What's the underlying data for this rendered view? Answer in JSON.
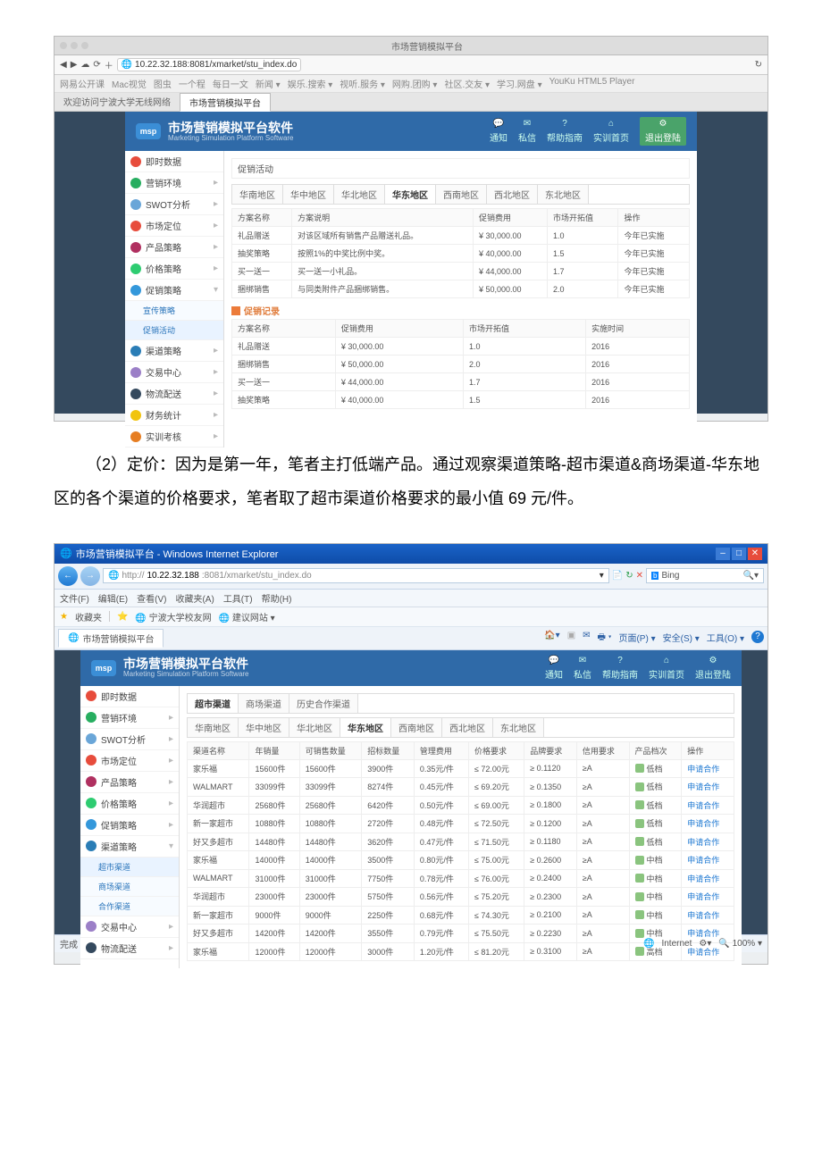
{
  "doc": {
    "paragraph": "（2）定价：因为是第一年，笔者主打低端产品。通过观察渠道策略-超市渠道&商场渠道-华东地区的各个渠道的价格要求，笔者取了超市渠道价格要求的最小值 69 元/件。"
  },
  "shot1": {
    "window_title": "市场营销模拟平台",
    "url": "10.22.32.188:8081/xmarket/stu_index.do",
    "bookmarks": [
      "网易公开课",
      "Mac视觉",
      "图虫",
      "一个程",
      "每日一文",
      "新闻 ▾",
      "娱乐.搜索 ▾",
      "视听.服务 ▾",
      "网购.团购 ▾",
      "社区.交友 ▾",
      "学习.网盘 ▾",
      "YouKu HTML5 Player"
    ],
    "tabs": [
      "欢迎访问宁波大学无线网络",
      "市场营销模拟平台"
    ],
    "app_title": "市场营销模拟平台软件",
    "app_sub": "Marketing Simulation Platform Software",
    "top_icons": [
      {
        "icon": "message-icon",
        "label": "通知"
      },
      {
        "icon": "mail-icon",
        "label": "私信"
      },
      {
        "icon": "help-icon",
        "label": "帮助指南"
      },
      {
        "icon": "home-icon",
        "label": "实训首页"
      },
      {
        "icon": "gear-icon",
        "label": "退出登陆",
        "hl": true
      }
    ],
    "sidebar": [
      {
        "label": "即时数据",
        "color": "#e74c3c"
      },
      {
        "label": "营销环境",
        "color": "#27ae60",
        "arrow": true
      },
      {
        "label": "SWOT分析",
        "color": "#6aa6d8",
        "arrow": true
      },
      {
        "label": "市场定位",
        "color": "#e74c3c",
        "arrow": true
      },
      {
        "label": "产品策略",
        "color": "#b03060",
        "arrow": true
      },
      {
        "label": "价格策略",
        "color": "#2ecc71",
        "arrow": true
      },
      {
        "label": "促销策略",
        "color": "#3498db",
        "expanded": true
      },
      {
        "label": "宣传策略",
        "sub": true
      },
      {
        "label": "促销活动",
        "sub": true,
        "active": true
      },
      {
        "label": "渠道策略",
        "color": "#2a7db6",
        "arrow": true
      },
      {
        "label": "交易中心",
        "color": "#9b7fc7",
        "arrow": true
      },
      {
        "label": "物流配送",
        "color": "#34495e",
        "arrow": true
      },
      {
        "label": "财务统计",
        "color": "#f1c40f",
        "arrow": true
      },
      {
        "label": "实训考核",
        "color": "#e67e22",
        "arrow": true
      }
    ],
    "content": {
      "box_label": "促销活动",
      "regions": [
        "华南地区",
        "华中地区",
        "华北地区",
        "华东地区",
        "西南地区",
        "西北地区",
        "东北地区"
      ],
      "active_region": 3,
      "table1": {
        "headers": [
          "方案名称",
          "方案说明",
          "促销费用",
          "市场开拓值",
          "操作"
        ],
        "rows": [
          [
            "礼品赠送",
            "对该区域所有销售产品赠送礼品。",
            "¥ 30,000.00",
            "1.0",
            "今年已实施"
          ],
          [
            "抽奖策略",
            "按照1%的中奖比例中奖。",
            "¥ 40,000.00",
            "1.5",
            "今年已实施"
          ],
          [
            "买一送一",
            "买一送一小礼品。",
            "¥ 44,000.00",
            "1.7",
            "今年已实施"
          ],
          [
            "捆绑销售",
            "与同类附件产品捆绑销售。",
            "¥ 50,000.00",
            "2.0",
            "今年已实施"
          ]
        ]
      },
      "section2_label": "促销记录",
      "table2": {
        "headers": [
          "方案名称",
          "促销费用",
          "市场开拓值",
          "实施时间"
        ],
        "rows": [
          [
            "礼品赠送",
            "¥ 30,000.00",
            "1.0",
            "2016"
          ],
          [
            "捆绑销售",
            "¥ 50,000.00",
            "2.0",
            "2016"
          ],
          [
            "买一送一",
            "¥ 44,000.00",
            "1.7",
            "2016"
          ],
          [
            "抽奖策略",
            "¥ 40,000.00",
            "1.5",
            "2016"
          ]
        ]
      }
    }
  },
  "shot2": {
    "ie_title": "市场营销模拟平台 - Windows Internet Explorer",
    "url_prefix": "http://",
    "url_host": "10.22.32.188",
    "url_rest": ":8081/xmarket/stu_index.do",
    "search_engine": "Bing",
    "menus": [
      "文件(F)",
      "编辑(E)",
      "查看(V)",
      "收藏夹(A)",
      "工具(T)",
      "帮助(H)"
    ],
    "fav_label": "收藏夹",
    "fav_items": [
      "宁波大学校友网",
      "建议网站 ▾"
    ],
    "tab_label": "市场营销模拟平台",
    "tabright": [
      "页面(P) ▾",
      "安全(S) ▾",
      "工具(O) ▾"
    ],
    "app_title": "市场营销模拟平台软件",
    "app_sub": "Marketing Simulation Platform Software",
    "top_icons": [
      {
        "icon": "message-icon",
        "label": "通知"
      },
      {
        "icon": "mail-icon",
        "label": "私信"
      },
      {
        "icon": "help-icon",
        "label": "帮助指南"
      },
      {
        "icon": "home-icon",
        "label": "实训首页"
      },
      {
        "icon": "gear-icon",
        "label": "退出登陆"
      }
    ],
    "sidebar": [
      {
        "label": "即时数据",
        "color": "#e74c3c"
      },
      {
        "label": "营销环境",
        "color": "#27ae60",
        "arrow": true
      },
      {
        "label": "SWOT分析",
        "color": "#6aa6d8",
        "arrow": true
      },
      {
        "label": "市场定位",
        "color": "#e74c3c",
        "arrow": true
      },
      {
        "label": "产品策略",
        "color": "#b03060",
        "arrow": true
      },
      {
        "label": "价格策略",
        "color": "#2ecc71",
        "arrow": true
      },
      {
        "label": "促销策略",
        "color": "#3498db",
        "arrow": true
      },
      {
        "label": "渠道策略",
        "color": "#2a7db6",
        "expanded": true
      },
      {
        "label": "超市渠道",
        "sub": true,
        "active": true
      },
      {
        "label": "商场渠道",
        "sub": true
      },
      {
        "label": "合作渠道",
        "sub": true
      },
      {
        "label": "交易中心",
        "color": "#9b7fc7",
        "arrow": true
      },
      {
        "label": "物流配送",
        "color": "#34495e",
        "arrow": true
      }
    ],
    "content": {
      "channel_tabs": [
        "超市渠道",
        "商场渠道",
        "历史合作渠道"
      ],
      "regions": [
        "华南地区",
        "华中地区",
        "华北地区",
        "华东地区",
        "西南地区",
        "西北地区",
        "东北地区"
      ],
      "active_region": 3,
      "headers": [
        "渠道名称",
        "年销量",
        "可销售数量",
        "招标数量",
        "管理费用",
        "价格要求",
        "品牌要求",
        "信用要求",
        "产品档次",
        "操作"
      ],
      "op_text": "申请合作",
      "rows": [
        [
          "家乐福",
          "15600件",
          "15600件",
          "3900件",
          "0.35元/件",
          "≤ 72.00元",
          "≥ 0.1120",
          "≥A",
          "低档"
        ],
        [
          "WALMART",
          "33099件",
          "33099件",
          "8274件",
          "0.45元/件",
          "≤ 69.20元",
          "≥ 0.1350",
          "≥A",
          "低档"
        ],
        [
          "华润超市",
          "25680件",
          "25680件",
          "6420件",
          "0.50元/件",
          "≤ 69.00元",
          "≥ 0.1800",
          "≥A",
          "低档"
        ],
        [
          "新一家超市",
          "10880件",
          "10880件",
          "2720件",
          "0.48元/件",
          "≤ 72.50元",
          "≥ 0.1200",
          "≥A",
          "低档"
        ],
        [
          "好又多超市",
          "14480件",
          "14480件",
          "3620件",
          "0.47元/件",
          "≤ 71.50元",
          "≥ 0.1180",
          "≥A",
          "低档"
        ],
        [
          "家乐福",
          "14000件",
          "14000件",
          "3500件",
          "0.80元/件",
          "≤ 75.00元",
          "≥ 0.2600",
          "≥A",
          "中档"
        ],
        [
          "WALMART",
          "31000件",
          "31000件",
          "7750件",
          "0.78元/件",
          "≤ 76.00元",
          "≥ 0.2400",
          "≥A",
          "中档"
        ],
        [
          "华润超市",
          "23000件",
          "23000件",
          "5750件",
          "0.56元/件",
          "≤ 75.20元",
          "≥ 0.2300",
          "≥A",
          "中档"
        ],
        [
          "新一家超市",
          "9000件",
          "9000件",
          "2250件",
          "0.68元/件",
          "≤ 74.30元",
          "≥ 0.2100",
          "≥A",
          "中档"
        ],
        [
          "好又多超市",
          "14200件",
          "14200件",
          "3550件",
          "0.79元/件",
          "≤ 75.50元",
          "≥ 0.2230",
          "≥A",
          "中档"
        ],
        [
          "家乐福",
          "12000件",
          "12000件",
          "3000件",
          "1.20元/件",
          "≤ 81.20元",
          "≥ 0.3100",
          "≥A",
          "高档"
        ]
      ]
    },
    "status_left": "完成",
    "status_zone": "Internet",
    "status_zoom": "100%"
  }
}
